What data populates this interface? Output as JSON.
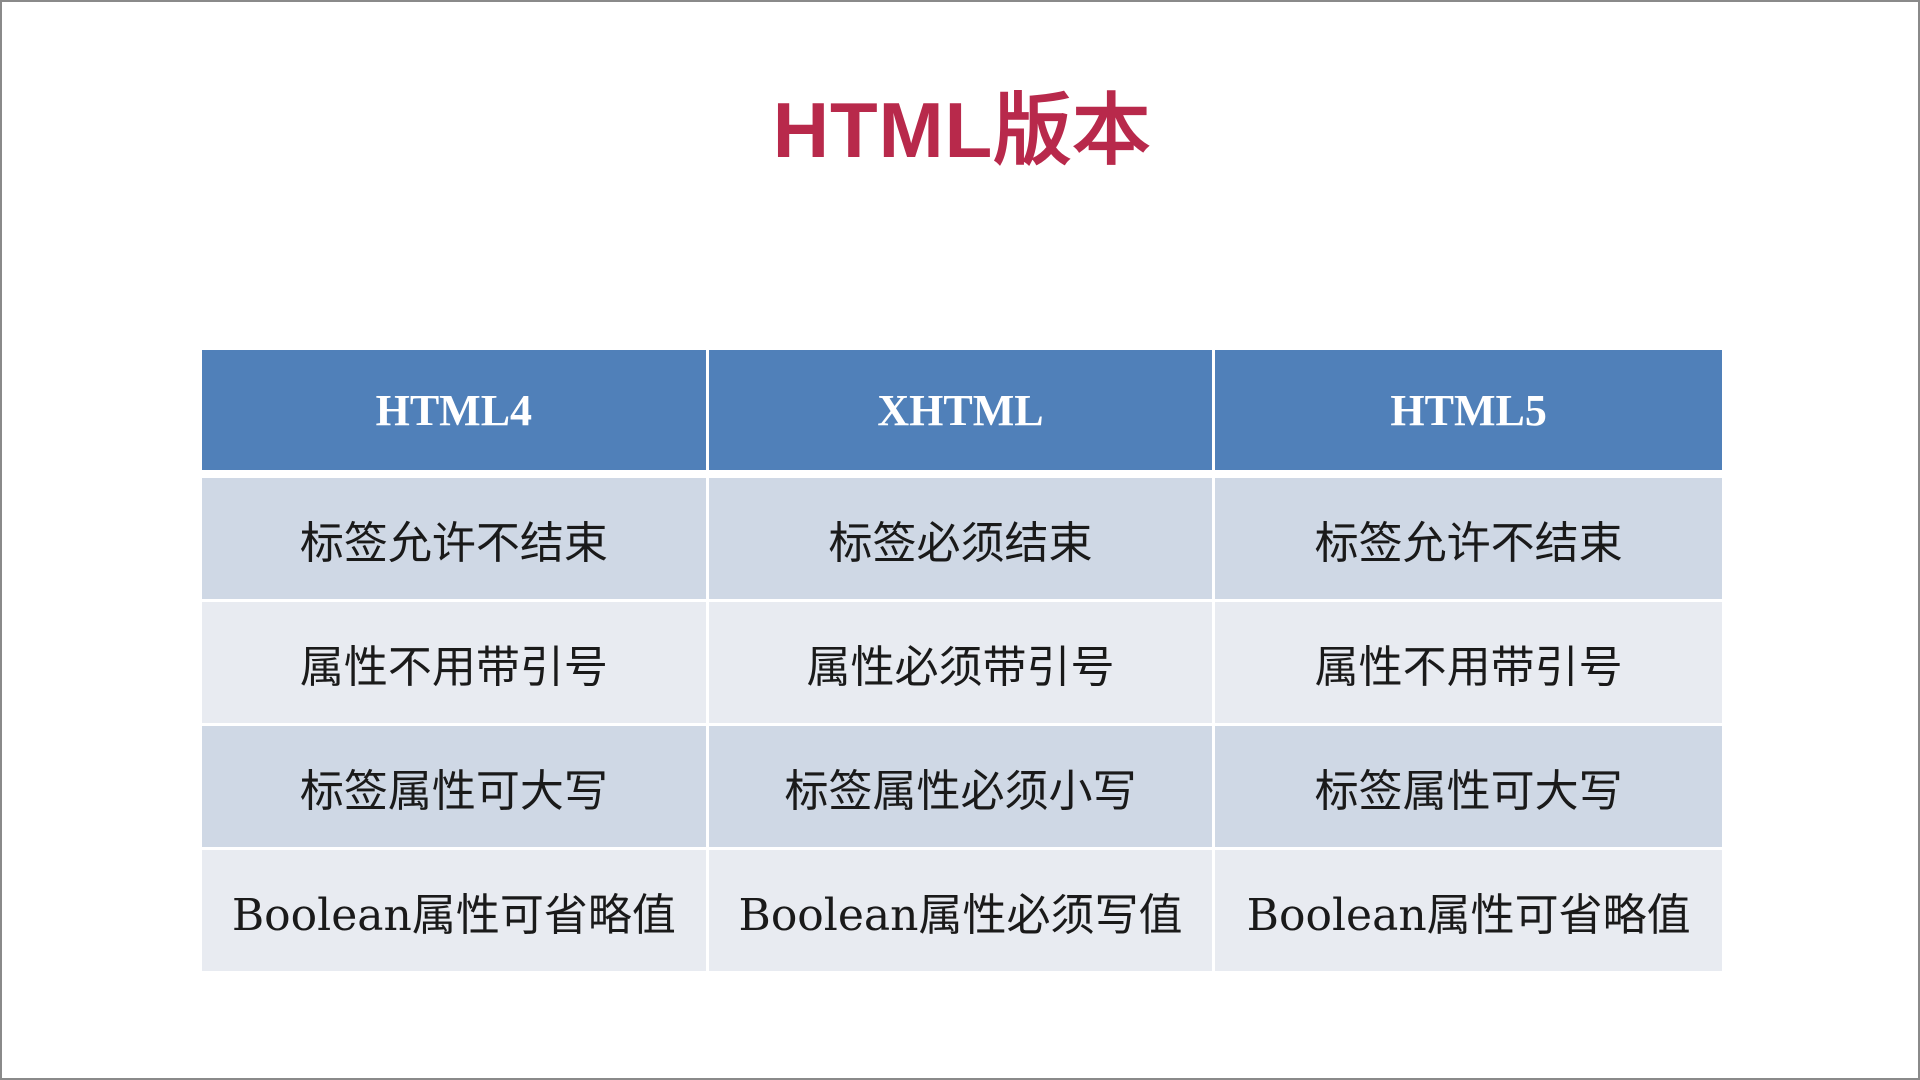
{
  "slide": {
    "title": "HTML版本"
  },
  "table": {
    "headers": [
      "HTML4",
      "XHTML",
      "HTML5"
    ],
    "rows": [
      [
        "标签允许不结束",
        "标签必须结束",
        "标签允许不结束"
      ],
      [
        "属性不用带引号",
        "属性必须带引号",
        "属性不用带引号"
      ],
      [
        "标签属性可大写",
        "标签属性必须小写",
        "标签属性可大写"
      ],
      [
        "Boolean属性可省略值",
        "Boolean属性必须写值",
        "Boolean属性可省略值"
      ]
    ]
  },
  "colors": {
    "title": "#b8294b",
    "header_bg": "#5080b9",
    "row_odd_bg": "#cfd8e5",
    "row_even_bg": "#e8ebf1"
  }
}
